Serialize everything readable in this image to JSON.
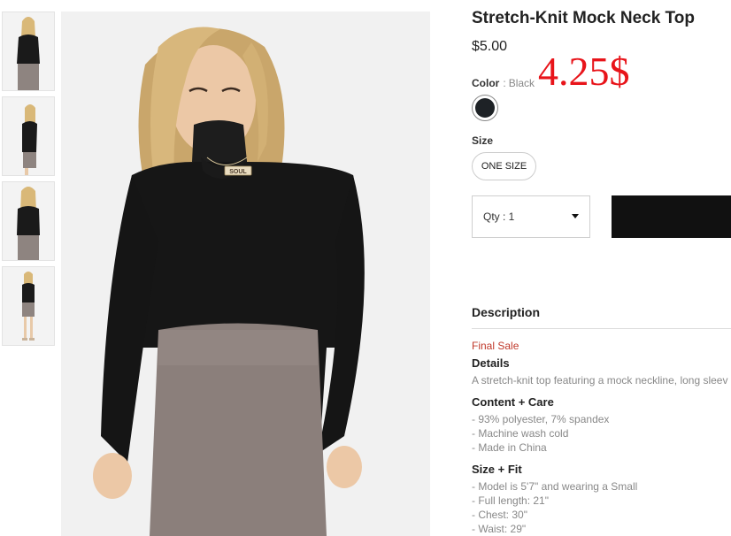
{
  "product": {
    "title": "Stretch-Knit Mock Neck Top",
    "price": "$5.00",
    "annotation": "4.25$"
  },
  "color": {
    "label": "Color",
    "separator": ":",
    "value": "Black",
    "swatch_color": "#1e2226"
  },
  "size": {
    "label": "Size",
    "option": "ONE SIZE"
  },
  "quantity": {
    "label": "Qty : 1"
  },
  "description": {
    "title": "Description",
    "final_sale": "Final Sale",
    "details_label": "Details",
    "details_text": "A stretch-knit top featuring a mock neckline, long sleev",
    "content_label": "Content + Care",
    "content_items": [
      "- 93% polyester, 7% spandex",
      "- Machine wash cold",
      "- Made in China"
    ],
    "fit_label": "Size + Fit",
    "fit_items": [
      "- Model is 5'7\" and wearing a Small",
      "- Full length: 21\"",
      "- Chest: 30\"",
      "- Waist: 29\""
    ]
  },
  "necklace_text": "SOUL"
}
